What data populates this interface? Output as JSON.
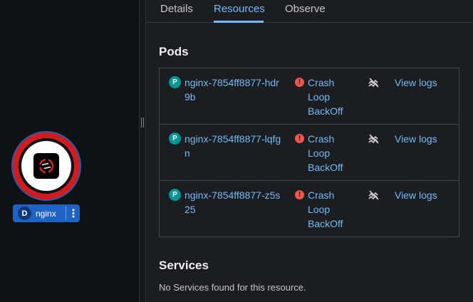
{
  "topology": {
    "node": {
      "badge": "D",
      "name": "nginx",
      "status_color": "#d01c1c",
      "icon": "openshift-logo-icon"
    }
  },
  "panel": {
    "tabs": [
      {
        "label": "Details",
        "active": false
      },
      {
        "label": "Resources",
        "active": true
      },
      {
        "label": "Observe",
        "active": false
      }
    ],
    "pods": {
      "title": "Pods",
      "items": [
        {
          "badge": "P",
          "name": "nginx-7854ff8877-hdr9b",
          "status": "Crash Loop BackOff",
          "action": "View logs"
        },
        {
          "badge": "P",
          "name": "nginx-7854ff8877-lqfgn",
          "status": "Crash Loop BackOff",
          "action": "View logs"
        },
        {
          "badge": "P",
          "name": "nginx-7854ff8877-z5s25",
          "status": "Crash Loop BackOff",
          "action": "View logs"
        }
      ]
    },
    "services": {
      "title": "Services",
      "empty": "No Services found for this resource."
    }
  },
  "colors": {
    "link": "#73bcf7",
    "error": "#f0564a",
    "pod_badge": "#009596",
    "accent": "#1e63c4"
  }
}
